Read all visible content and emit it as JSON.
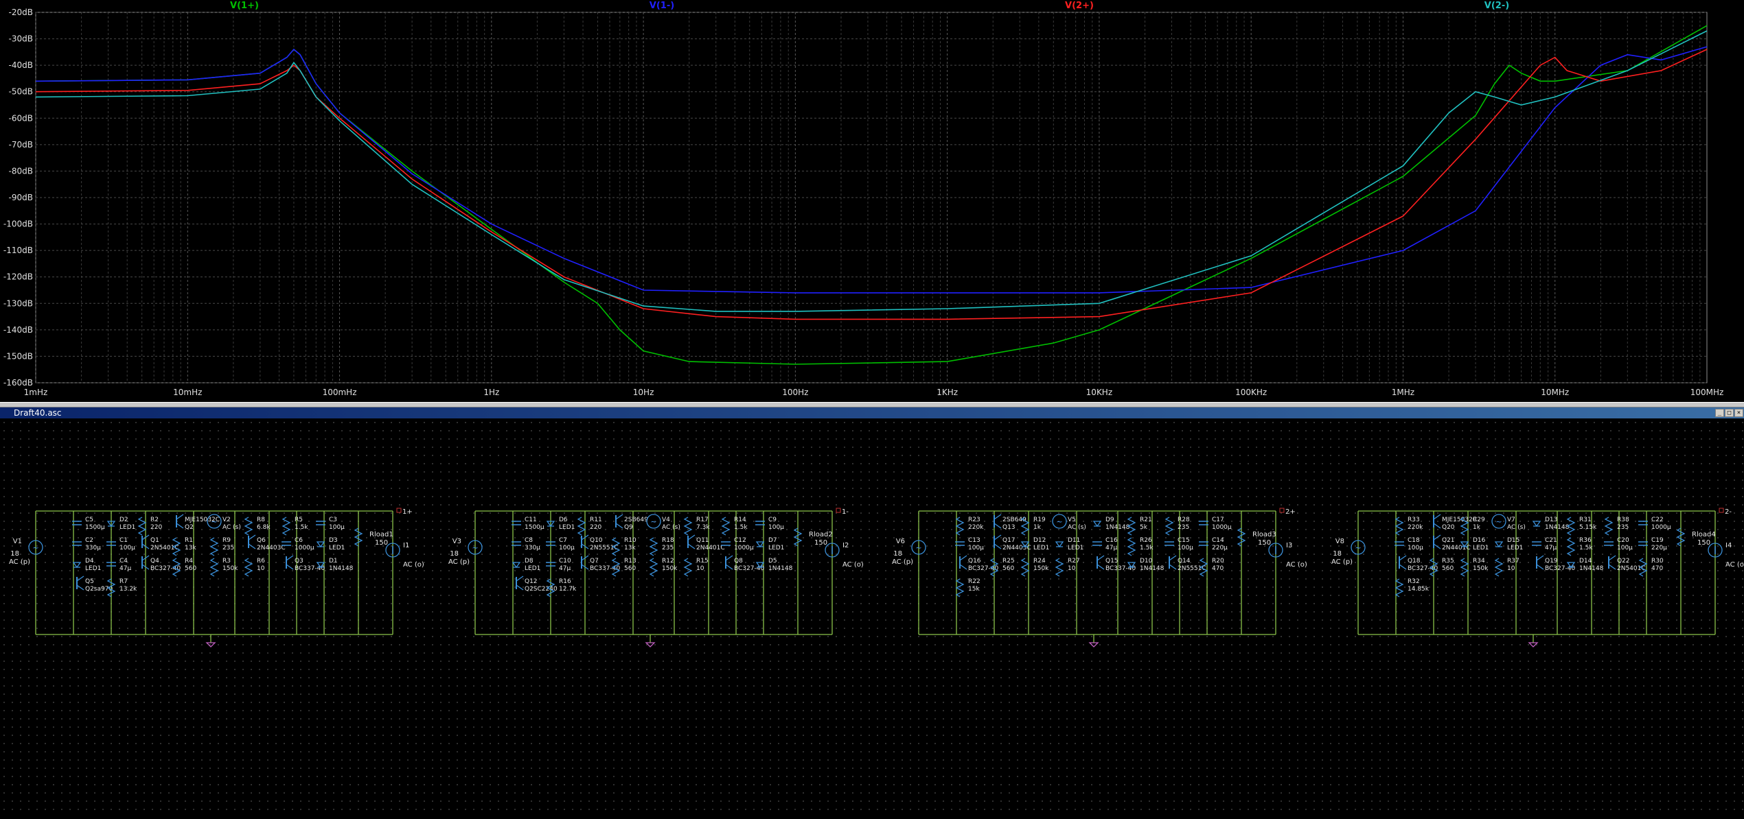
{
  "plot": {
    "traces": [
      {
        "name": "V(1+)",
        "color": "#00c000"
      },
      {
        "name": "V(1-)",
        "color": "#2020ff"
      },
      {
        "name": "V(2+)",
        "color": "#ff2020"
      },
      {
        "name": "V(2-)",
        "color": "#20c0c0"
      }
    ],
    "y_ticks": [
      "-20dB",
      "-30dB",
      "-40dB",
      "-50dB",
      "-60dB",
      "-70dB",
      "-80dB",
      "-90dB",
      "-100dB",
      "-110dB",
      "-120dB",
      "-130dB",
      "-140dB",
      "-150dB",
      "-160dB"
    ],
    "x_ticks": [
      "1mHz",
      "10mHz",
      "100mHz",
      "1Hz",
      "10Hz",
      "100Hz",
      "1KHz",
      "10KHz",
      "100KHz",
      "1MHz",
      "10MHz",
      "100MHz"
    ]
  },
  "chart_data": {
    "type": "line",
    "x_scale": "log",
    "xlim": [
      0.001,
      100000000
    ],
    "ylim": [
      -160,
      -20
    ],
    "xlabel": "",
    "ylabel": "",
    "grid": true,
    "legend": "top",
    "series": [
      {
        "name": "V(1+)",
        "color": "#00c000",
        "x": [
          0.001,
          0.01,
          0.03,
          0.045,
          0.05,
          0.055,
          0.07,
          0.1,
          0.3,
          1,
          3,
          5,
          7,
          10,
          20,
          100,
          1000,
          5000,
          10000,
          100000,
          1000000,
          3000000,
          4000000,
          5000000,
          6000000,
          8000000,
          10000000,
          30000000,
          100000000
        ],
        "y": [
          -46,
          -45.5,
          -43,
          -37,
          -34,
          -36,
          -47,
          -58,
          -80,
          -102,
          -122,
          -130,
          -140,
          -148,
          -152,
          -153,
          -152,
          -145,
          -140,
          -113,
          -82,
          -59,
          -47,
          -40,
          -43,
          -46,
          -46,
          -42,
          -25
        ]
      },
      {
        "name": "V(1-)",
        "color": "#2020ff",
        "x": [
          0.001,
          0.01,
          0.03,
          0.045,
          0.05,
          0.055,
          0.07,
          0.1,
          0.3,
          1,
          3,
          10,
          100,
          1000,
          10000,
          100000,
          1000000,
          3000000,
          10000000,
          20000000,
          30000000,
          50000000,
          100000000
        ],
        "y": [
          -46,
          -45.5,
          -43,
          -37,
          -34,
          -36,
          -47,
          -58,
          -81,
          -100,
          -113,
          -125,
          -126,
          -126,
          -126,
          -124,
          -110,
          -95,
          -56,
          -40,
          -36,
          -38,
          -33
        ]
      },
      {
        "name": "V(2+)",
        "color": "#ff2020",
        "x": [
          0.001,
          0.01,
          0.03,
          0.045,
          0.05,
          0.055,
          0.07,
          0.1,
          0.3,
          1,
          3,
          10,
          30,
          100,
          1000,
          10000,
          100000,
          1000000,
          3000000,
          8000000,
          10000000,
          12000000,
          20000000,
          50000000,
          100000000
        ],
        "y": [
          -50,
          -49.5,
          -47,
          -42,
          -40,
          -42,
          -52,
          -60,
          -83,
          -103,
          -120,
          -132,
          -135,
          -136,
          -136,
          -135,
          -126,
          -97,
          -68,
          -40,
          -37,
          -42,
          -46,
          -42,
          -34
        ]
      },
      {
        "name": "V(2-)",
        "color": "#20c0c0",
        "x": [
          0.001,
          0.01,
          0.03,
          0.045,
          0.05,
          0.055,
          0.07,
          0.1,
          0.3,
          1,
          3,
          10,
          30,
          100,
          1000,
          10000,
          100000,
          1000000,
          2000000,
          3000000,
          4000000,
          6000000,
          10000000,
          30000000,
          100000000
        ],
        "y": [
          -52,
          -51.5,
          -49,
          -43,
          -39,
          -42,
          -52,
          -61,
          -85,
          -104,
          -121,
          -131,
          -133,
          -133,
          -132,
          -130,
          -112,
          -78,
          -58,
          -50,
          -52,
          -55,
          -52,
          -42,
          -27
        ]
      }
    ]
  },
  "schematic": {
    "window_title": "Draft40.asc",
    "circuits": [
      {
        "in_src": "V1",
        "in_v": "18",
        "in_ac": "AC (p)",
        "net": "1+",
        "load": "Rload1",
        "load_v": "150",
        "out_src": "I1",
        "out_ac": "AC (o)",
        "comps": [
          "C5",
          "1500µ",
          "D2",
          "LED1",
          "R2",
          "220",
          "MJE15032C",
          "Q2",
          "V2",
          "AC (s)",
          "R8",
          "6.8k",
          "R5",
          "1.5k",
          "C3",
          "100µ",
          "C2",
          "330µ",
          "C1",
          "100µ",
          "Q1",
          "2N5401C",
          "R1",
          "13k",
          "R9",
          "235",
          "Q6",
          "2N4403C",
          "C6",
          "1000µ",
          "D3",
          "LED1",
          "D4",
          "LED1",
          "C4",
          "47µ",
          "Q4",
          "BC327-40",
          "R4",
          "560",
          "R3",
          "150k",
          "R6",
          "10",
          "Q3",
          "BC337-40",
          "D1",
          "1N4148",
          "Q5",
          "Q2sa970",
          "R7",
          "13.2k"
        ]
      },
      {
        "in_src": "V3",
        "in_v": "18",
        "in_ac": "AC (p)",
        "net": "1-",
        "load": "Rload2",
        "load_v": "150",
        "out_src": "I2",
        "out_ac": "AC (o)",
        "comps": [
          "C11",
          "1500µ",
          "D6",
          "LED1",
          "R11",
          "220",
          "2SB649",
          "Q9",
          "V4",
          "AC (s)",
          "R17",
          "7.3k",
          "R14",
          "1.5k",
          "C9",
          "100µ",
          "C8",
          "330µ",
          "C7",
          "100µ",
          "Q10",
          "2N5551C",
          "R10",
          "13k",
          "R18",
          "235",
          "Q11",
          "2N4401C",
          "C12",
          "1000µ",
          "D7",
          "LED1",
          "D8",
          "LED1",
          "C10",
          "47µ",
          "Q7",
          "BC337-40",
          "R13",
          "560",
          "R12",
          "150k",
          "R15",
          "10",
          "Q8",
          "BC327-40",
          "D5",
          "1N4148",
          "Q12",
          "Q2SC2240",
          "R16",
          "12.7k"
        ]
      },
      {
        "in_src": "V6",
        "in_v": "18",
        "in_ac": "AC (p)",
        "net": "2+",
        "load": "Rload3",
        "load_v": "150",
        "out_src": "I3",
        "out_ac": "AC (o)",
        "comps": [
          "R23",
          "220k",
          "2SB649",
          "Q13",
          "R19",
          "1k",
          "V5",
          "AC (s)",
          "D9",
          "1N4148",
          "R21",
          "5k",
          "R28",
          "235",
          "C17",
          "1000µ",
          "C13",
          "100µ",
          "Q17",
          "2N4403C",
          "D12",
          "LED1",
          "D11",
          "LED1",
          "C16",
          "47µ",
          "R26",
          "1.5k",
          "C15",
          "100µ",
          "C14",
          "220µ",
          "Q16",
          "BC327-40",
          "R25",
          "560",
          "R24",
          "150k",
          "R27",
          "10",
          "Q15",
          "BC337-40",
          "D10",
          "1N4148",
          "Q14",
          "2N5551C",
          "R20",
          "470",
          "R22",
          "15k"
        ]
      },
      {
        "in_src": "V8",
        "in_v": "18",
        "in_ac": "AC (p)",
        "net": "2-",
        "load": "Rload4",
        "load_v": "150",
        "out_src": "I4",
        "out_ac": "AC (o)",
        "comps": [
          "R33",
          "220k",
          "MJE15032C",
          "Q20",
          "R29",
          "1k",
          "V7",
          "AC (s)",
          "D13",
          "1N4148",
          "R31",
          "5.15k",
          "R38",
          "235",
          "C22",
          "1000µ",
          "C18",
          "100µ",
          "Q21",
          "2N4401C",
          "D16",
          "LED1",
          "D15",
          "LED1",
          "C21",
          "47µ",
          "R36",
          "1.5k",
          "C20",
          "100µ",
          "C19",
          "220µ",
          "Q18",
          "BC327-40",
          "R35",
          "560",
          "R34",
          "150k",
          "R37",
          "10",
          "Q19",
          "BC327-40",
          "D14",
          "1N4148",
          "Q22",
          "2N5401C",
          "R30",
          "470",
          "R32",
          "14.85k"
        ]
      }
    ]
  }
}
